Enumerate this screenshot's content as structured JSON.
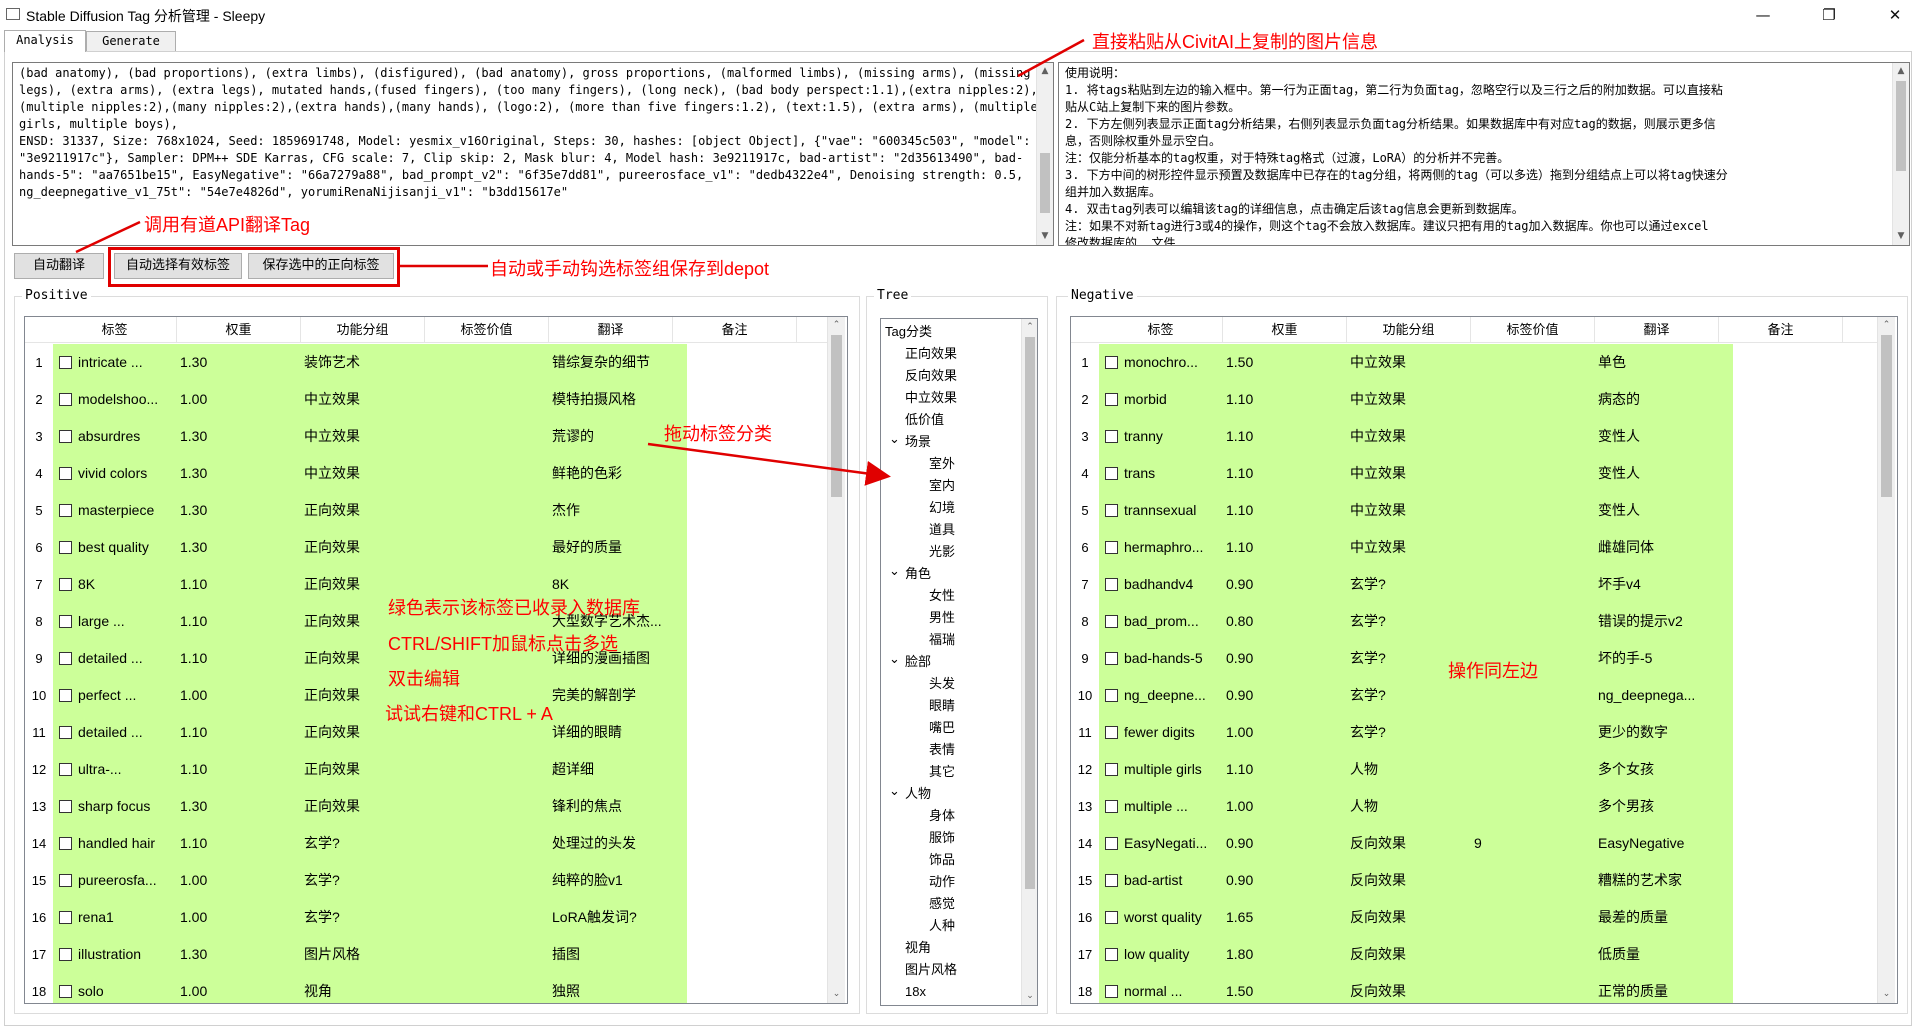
{
  "window": {
    "title": "Stable Diffusion Tag 分析管理 - Sleepy",
    "controls": {
      "minimize": "—",
      "maximize": "❐",
      "close": "✕"
    }
  },
  "tabs": [
    {
      "label": "Analysis"
    },
    {
      "label": "Generate"
    }
  ],
  "prompt_text": "(bad anatomy), (bad proportions), (extra limbs), (disfigured), (bad anatomy), gross proportions, (malformed limbs), (missing arms), (missing legs), (extra arms), (extra legs), mutated hands,(fused fingers), (too many fingers), (long neck), (bad body perspect:1.1),(extra nipples:2),(multiple nipples:2),(many nipples:2),(extra hands),(many hands), (logo:2), (more than five fingers:1.2), (text:1.5), (extra arms), (multiple girls, multiple boys),\nENSD: 31337, Size: 768x1024, Seed: 1859691748, Model: yesmix_v16Original, Steps: 30, hashes: [object Object], {\"vae\": \"600345c503\", \"model\": \"3e9211917c\"}, Sampler: DPM++ SDE Karras, CFG scale: 7, Clip skip: 2, Mask blur: 4, Model hash: 3e9211917c, bad-artist\": \"2d35613490\", bad-hands-5\": \"aa7651be15\", EasyNegative\": \"66a7279a88\", bad_prompt_v2\": \"6f35e7dd81\", pureerosface_v1\": \"dedb4322e4\", Denoising strength: 0.5, ng_deepnegative_v1_75t\": \"54e7e4826d\", yorumiRenaNijisanji_v1\": \"b3dd15617e\"",
  "usage_lines": [
    "使用说明：",
    "1. 将tags粘贴到左边的输入框中。第一行为正面tag，第二行为负面tag，忽略空行以及三行之后的附加数据。可以直接粘",
    "贴从C站上复制下来的图片参数。",
    "2. 下方左侧列表显示正面tag分析结果，右侧列表显示负面tag分析结果。如果数据库中有对应tag的数据，则展示更多信",
    "息，否则除权重外显示空白。",
    "   注：仅能分析基本的tag权重，对于特殊tag格式（过渡，LoRA）的分析并不完善。",
    "3. 下方中间的树形控件显示预置及数据库中已存在的tag分组，将两侧的tag（可以多选）拖到分组结点上可以将tag快速分",
    "组并加入数据库。",
    "4. 双击tag列表可以编辑该tag的详细信息，点击确定后该tag信息会更新到数据库。",
    "   注：如果不对新tag进行3或4的操作，则这个tag不会放入数据库。建议只把有用的tag加入数据库。你也可以通过excel",
    "修改数据库的……文件"
  ],
  "buttons": {
    "auto_translate": "自动翻译",
    "auto_select": "自动选择有效标签",
    "save_selected": "保存选中的正向标签"
  },
  "groups": {
    "positive": "Positive",
    "tree": "Tree",
    "negative": "Negative"
  },
  "columns": [
    "标签",
    "权重",
    "功能分组",
    "标签价值",
    "翻译",
    "备注"
  ],
  "positive_rows": [
    {
      "idx": "1",
      "tag": "intricate ...",
      "weight": "1.30",
      "group": "装饰艺术",
      "value": "",
      "translation": "错综复杂的细节",
      "note": ""
    },
    {
      "idx": "2",
      "tag": "modelshoo...",
      "weight": "1.00",
      "group": "中立效果",
      "value": "",
      "translation": "模特拍摄风格",
      "note": ""
    },
    {
      "idx": "3",
      "tag": "absurdres",
      "weight": "1.30",
      "group": "中立效果",
      "value": "",
      "translation": "荒谬的",
      "note": ""
    },
    {
      "idx": "4",
      "tag": "vivid colors",
      "weight": "1.30",
      "group": "中立效果",
      "value": "",
      "translation": "鲜艳的色彩",
      "note": ""
    },
    {
      "idx": "5",
      "tag": "masterpiece",
      "weight": "1.30",
      "group": "正向效果",
      "value": "",
      "translation": "杰作",
      "note": ""
    },
    {
      "idx": "6",
      "tag": "best quality",
      "weight": "1.30",
      "group": "正向效果",
      "value": "",
      "translation": "最好的质量",
      "note": ""
    },
    {
      "idx": "7",
      "tag": "8K",
      "weight": "1.10",
      "group": "正向效果",
      "value": "",
      "translation": "8K",
      "note": ""
    },
    {
      "idx": "8",
      "tag": "large ...",
      "weight": "1.10",
      "group": "正向效果",
      "value": "",
      "translation": "大型数字艺术杰...",
      "note": ""
    },
    {
      "idx": "9",
      "tag": "detailed ...",
      "weight": "1.10",
      "group": "正向效果",
      "value": "",
      "translation": "详细的漫画插图",
      "note": ""
    },
    {
      "idx": "10",
      "tag": "perfect ...",
      "weight": "1.00",
      "group": "正向效果",
      "value": "",
      "translation": "完美的解剖学",
      "note": ""
    },
    {
      "idx": "11",
      "tag": "detailed ...",
      "weight": "1.10",
      "group": "正向效果",
      "value": "",
      "translation": "详细的眼睛",
      "note": ""
    },
    {
      "idx": "12",
      "tag": "ultra-...",
      "weight": "1.10",
      "group": "正向效果",
      "value": "",
      "translation": "超详细",
      "note": ""
    },
    {
      "idx": "13",
      "tag": "sharp focus",
      "weight": "1.30",
      "group": "正向效果",
      "value": "",
      "translation": "锋利的焦点",
      "note": ""
    },
    {
      "idx": "14",
      "tag": "handled hair",
      "weight": "1.10",
      "group": "玄学?",
      "value": "",
      "translation": "处理过的头发",
      "note": ""
    },
    {
      "idx": "15",
      "tag": "pureerosfa...",
      "weight": "1.00",
      "group": "玄学?",
      "value": "",
      "translation": "纯粹的脸v1",
      "note": ""
    },
    {
      "idx": "16",
      "tag": "rena1",
      "weight": "1.00",
      "group": "玄学?",
      "value": "",
      "translation": "LoRA触发词?",
      "note": ""
    },
    {
      "idx": "17",
      "tag": "illustration",
      "weight": "1.30",
      "group": "图片风格",
      "value": "",
      "translation": "插图",
      "note": ""
    },
    {
      "idx": "18",
      "tag": "solo",
      "weight": "1.00",
      "group": "视角",
      "value": "",
      "translation": "独照",
      "note": ""
    }
  ],
  "negative_rows": [
    {
      "idx": "1",
      "tag": "monochro...",
      "weight": "1.50",
      "group": "中立效果",
      "value": "",
      "translation": "单色",
      "note": ""
    },
    {
      "idx": "2",
      "tag": "morbid",
      "weight": "1.10",
      "group": "中立效果",
      "value": "",
      "translation": "病态的",
      "note": ""
    },
    {
      "idx": "3",
      "tag": "tranny",
      "weight": "1.10",
      "group": "中立效果",
      "value": "",
      "translation": "变性人",
      "note": ""
    },
    {
      "idx": "4",
      "tag": "trans",
      "weight": "1.10",
      "group": "中立效果",
      "value": "",
      "translation": "变性人",
      "note": ""
    },
    {
      "idx": "5",
      "tag": "trannsexual",
      "weight": "1.10",
      "group": "中立效果",
      "value": "",
      "translation": "变性人",
      "note": ""
    },
    {
      "idx": "6",
      "tag": "hermaphro...",
      "weight": "1.10",
      "group": "中立效果",
      "value": "",
      "translation": "雌雄同体",
      "note": ""
    },
    {
      "idx": "7",
      "tag": "badhandv4",
      "weight": "0.90",
      "group": "玄学?",
      "value": "",
      "translation": "坏手v4",
      "note": ""
    },
    {
      "idx": "8",
      "tag": "bad_prom...",
      "weight": "0.80",
      "group": "玄学?",
      "value": "",
      "translation": "错误的提示v2",
      "note": ""
    },
    {
      "idx": "9",
      "tag": "bad-hands-5",
      "weight": "0.90",
      "group": "玄学?",
      "value": "",
      "translation": "坏的手-5",
      "note": ""
    },
    {
      "idx": "10",
      "tag": "ng_deepne...",
      "weight": "0.90",
      "group": "玄学?",
      "value": "",
      "translation": "ng_deepnega...",
      "note": ""
    },
    {
      "idx": "11",
      "tag": "fewer digits",
      "weight": "1.00",
      "group": "玄学?",
      "value": "",
      "translation": "更少的数字",
      "note": ""
    },
    {
      "idx": "12",
      "tag": "multiple girls",
      "weight": "1.10",
      "group": "人物",
      "value": "",
      "translation": "多个女孩",
      "note": ""
    },
    {
      "idx": "13",
      "tag": "multiple ...",
      "weight": "1.00",
      "group": "人物",
      "value": "",
      "translation": "多个男孩",
      "note": ""
    },
    {
      "idx": "14",
      "tag": "EasyNegati...",
      "weight": "0.90",
      "group": "反向效果",
      "value": "9",
      "translation": "EasyNegative",
      "note": ""
    },
    {
      "idx": "15",
      "tag": "bad-artist",
      "weight": "0.90",
      "group": "反向效果",
      "value": "",
      "translation": "糟糕的艺术家",
      "note": ""
    },
    {
      "idx": "16",
      "tag": "worst quality",
      "weight": "1.65",
      "group": "反向效果",
      "value": "",
      "translation": "最差的质量",
      "note": ""
    },
    {
      "idx": "17",
      "tag": "low quality",
      "weight": "1.80",
      "group": "反向效果",
      "value": "",
      "translation": "低质量",
      "note": ""
    },
    {
      "idx": "18",
      "tag": "normal ...",
      "weight": "1.50",
      "group": "反向效果",
      "value": "",
      "translation": "正常的质量",
      "note": ""
    }
  ],
  "tree_nodes": [
    {
      "label": "Tag分类",
      "level": 0,
      "toggle": ""
    },
    {
      "label": "正向效果",
      "level": 1,
      "toggle": ""
    },
    {
      "label": "反向效果",
      "level": 1,
      "toggle": ""
    },
    {
      "label": "中立效果",
      "level": 1,
      "toggle": ""
    },
    {
      "label": "低价值",
      "level": 1,
      "toggle": ""
    },
    {
      "label": "场景",
      "level": 1,
      "toggle": "⌄"
    },
    {
      "label": "室外",
      "level": 2,
      "toggle": ""
    },
    {
      "label": "室内",
      "level": 2,
      "toggle": ""
    },
    {
      "label": "幻境",
      "level": 2,
      "toggle": ""
    },
    {
      "label": "道具",
      "level": 2,
      "toggle": ""
    },
    {
      "label": "光影",
      "level": 2,
      "toggle": ""
    },
    {
      "label": "角色",
      "level": 1,
      "toggle": "⌄"
    },
    {
      "label": "女性",
      "level": 2,
      "toggle": ""
    },
    {
      "label": "男性",
      "level": 2,
      "toggle": ""
    },
    {
      "label": "福瑞",
      "level": 2,
      "toggle": ""
    },
    {
      "label": "脸部",
      "level": 1,
      "toggle": "⌄"
    },
    {
      "label": "头发",
      "level": 2,
      "toggle": ""
    },
    {
      "label": "眼睛",
      "level": 2,
      "toggle": ""
    },
    {
      "label": "嘴巴",
      "level": 2,
      "toggle": ""
    },
    {
      "label": "表情",
      "level": 2,
      "toggle": ""
    },
    {
      "label": "其它",
      "level": 2,
      "toggle": ""
    },
    {
      "label": "人物",
      "level": 1,
      "toggle": "⌄"
    },
    {
      "label": "身体",
      "level": 2,
      "toggle": ""
    },
    {
      "label": "服饰",
      "level": 2,
      "toggle": ""
    },
    {
      "label": "饰品",
      "level": 2,
      "toggle": ""
    },
    {
      "label": "动作",
      "level": 2,
      "toggle": ""
    },
    {
      "label": "感觉",
      "level": 2,
      "toggle": ""
    },
    {
      "label": "人种",
      "level": 2,
      "toggle": ""
    },
    {
      "label": "视角",
      "level": 1,
      "toggle": ""
    },
    {
      "label": "图片风格",
      "level": 1,
      "toggle": ""
    },
    {
      "label": "18x",
      "level": 1,
      "toggle": ""
    }
  ],
  "annotations": {
    "paste_info": "直接粘贴从CivitAI上复制的图片信息",
    "youdao": "调用有道API翻译Tag",
    "save_depot": "自动或手动钩选标签组保存到depot",
    "drag": "拖动标签分类",
    "green_line1": "绿色表示该标签已收录入数据库",
    "green_line2": "CTRL/SHIFT加鼠标点击多选",
    "green_line3": "双击编辑",
    "green_line4": "试试右键和CTRL + A",
    "same_as_left": "操作同左边"
  },
  "colors": {
    "known_tag_row": "#ccff99",
    "annotation": "#ff0000"
  }
}
